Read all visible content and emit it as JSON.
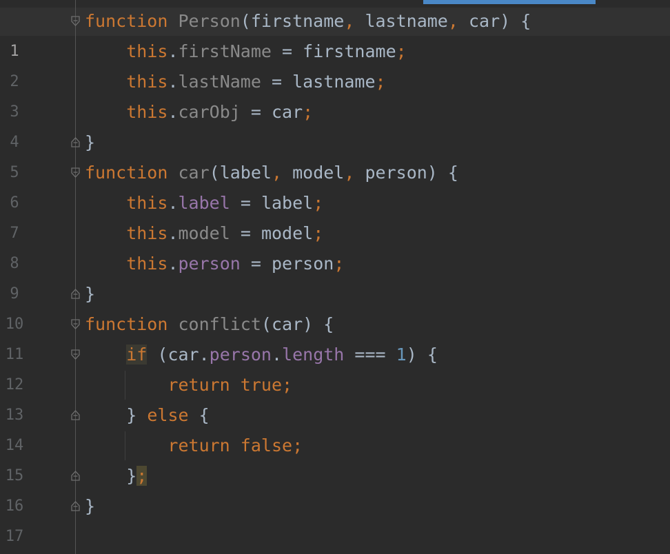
{
  "editor": {
    "language": "javascript",
    "current_line": 1,
    "lines": [
      {
        "n": "1"
      },
      {
        "n": "2"
      },
      {
        "n": "3"
      },
      {
        "n": "4"
      },
      {
        "n": "5"
      },
      {
        "n": "6"
      },
      {
        "n": "7"
      },
      {
        "n": "8"
      },
      {
        "n": "9"
      },
      {
        "n": "10"
      },
      {
        "n": "11"
      },
      {
        "n": "12"
      },
      {
        "n": "13"
      },
      {
        "n": "14"
      },
      {
        "n": "15"
      },
      {
        "n": "16"
      },
      {
        "n": "17"
      }
    ],
    "tokens": {
      "function": "function",
      "this": "this",
      "person_fn": "Person",
      "car_fn": "car",
      "conflict_fn": "conflict",
      "firstname": "firstname",
      "lastname": "lastname",
      "car": "car",
      "firstName": "firstName",
      "lastName": "lastName",
      "carObj": "carObj",
      "label": "label",
      "model": "model",
      "person": "person",
      "length": "length",
      "if": "if",
      "else": "else",
      "return": "return",
      "true": "true",
      "false": "false",
      "one": "1",
      "strict_eq": "===",
      "eq": "=",
      "open_brace": "{",
      "close_brace": "}",
      "open_paren": "(",
      "close_paren": ")",
      "comma": ",",
      "dot": ".",
      "semicolon": ";"
    }
  },
  "colors": {
    "background": "#2b2b2b",
    "keyword": "#cc7832",
    "default": "#a9b7c6",
    "property": "#9876aa",
    "number": "#6897bb",
    "line_number": "#606366",
    "scroll_indicator": "#4a88c7"
  }
}
